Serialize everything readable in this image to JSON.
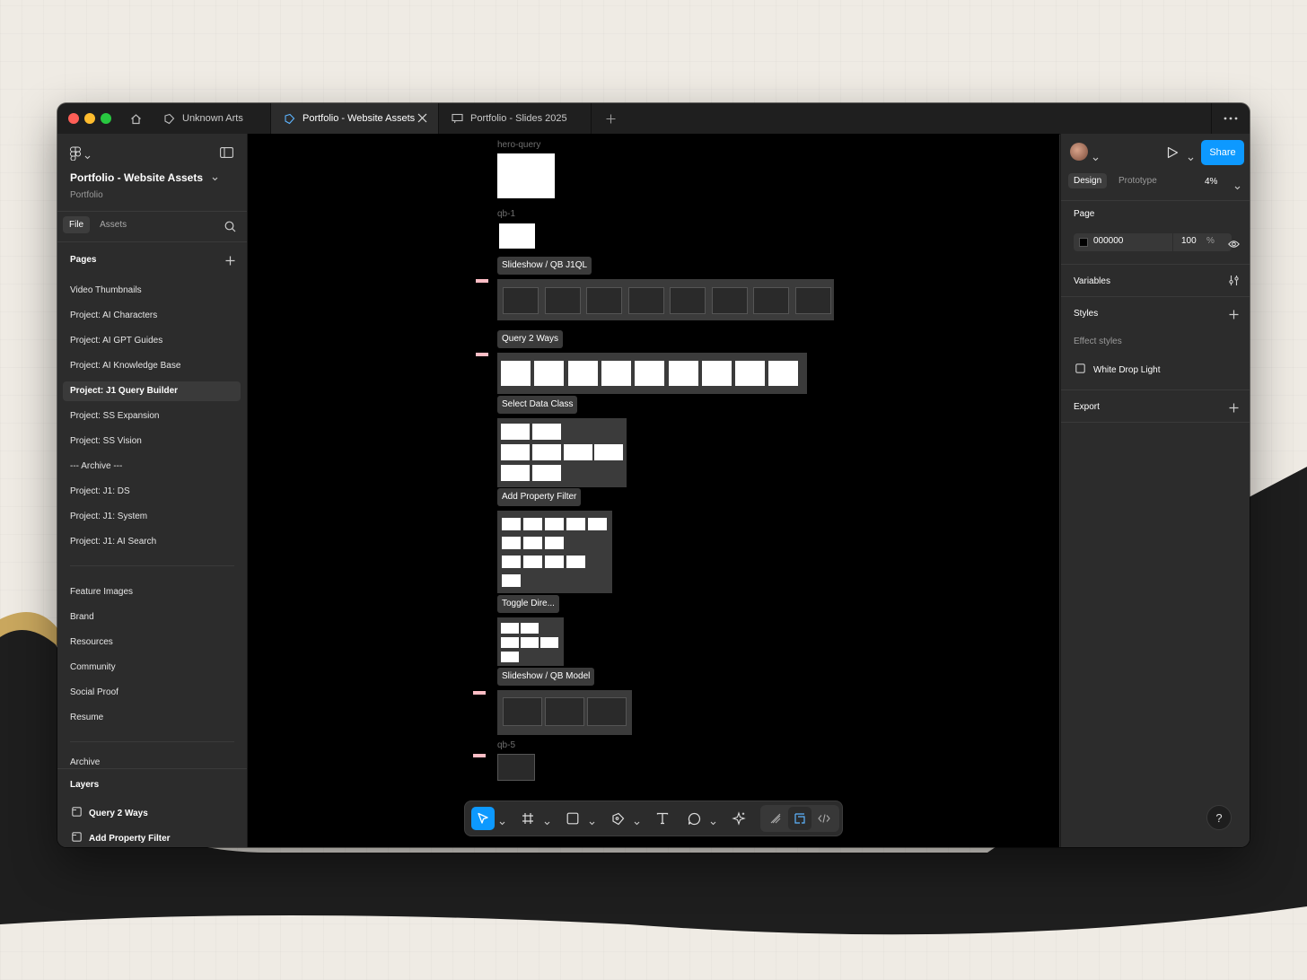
{
  "tabs": [
    {
      "label": "Unknown Arts",
      "icon": "figma-file-icon"
    },
    {
      "label": "Portfolio - Website Assets",
      "icon": "figma-file-icon",
      "active": true
    },
    {
      "label": "Portfolio - Slides 2025",
      "icon": "slides-icon"
    }
  ],
  "left": {
    "file_name": "Portfolio - Website Assets",
    "project": "Portfolio",
    "tab_file": "File",
    "tab_assets": "Assets",
    "pages_heading": "Pages",
    "pages": [
      "Video Thumbnails",
      "Project: AI Characters",
      "Project: AI GPT Guides",
      "Project: AI Knowledge Base",
      "Project: J1 Query Builder",
      "Project: SS Expansion",
      "Project: SS Vision",
      "--- Archive ---",
      "Project: J1: DS",
      "Project: J1: System",
      "Project: J1: AI Search"
    ],
    "selected_page": "Project: J1 Query Builder",
    "pages2": [
      "Feature Images",
      "Brand",
      "Resources",
      "Community",
      "Social Proof",
      "Resume"
    ],
    "pages3": [
      "Archive"
    ],
    "layers_heading": "Layers",
    "layers": [
      "Query 2 Ways",
      "Add Property Filter"
    ]
  },
  "canvas": {
    "frames": {
      "hero_query": "hero-query",
      "qb1": "qb-1",
      "qb5": "qb-5"
    },
    "sections": {
      "slideshow_j1ql": "Slideshow / QB J1QL",
      "query_2_ways": "Query 2 Ways",
      "select_data_class": "Select Data Class",
      "add_property_filter": "Add Property Filter",
      "toggle_dire": "Toggle Dire...",
      "slideshow_model": "Slideshow / QB Model"
    }
  },
  "right": {
    "share": "Share",
    "tab_design": "Design",
    "tab_prototype": "Prototype",
    "zoom": "4%",
    "page_heading": "Page",
    "page_color": "000000",
    "page_opacity": "100",
    "percent": "%",
    "variables": "Variables",
    "styles": "Styles",
    "effect_styles": "Effect styles",
    "effect_style_name": "White Drop Light",
    "export": "Export",
    "help": "?"
  },
  "colors": {
    "accent": "#0d99ff",
    "panel": "#2c2c2c",
    "canvas": "#000000"
  }
}
